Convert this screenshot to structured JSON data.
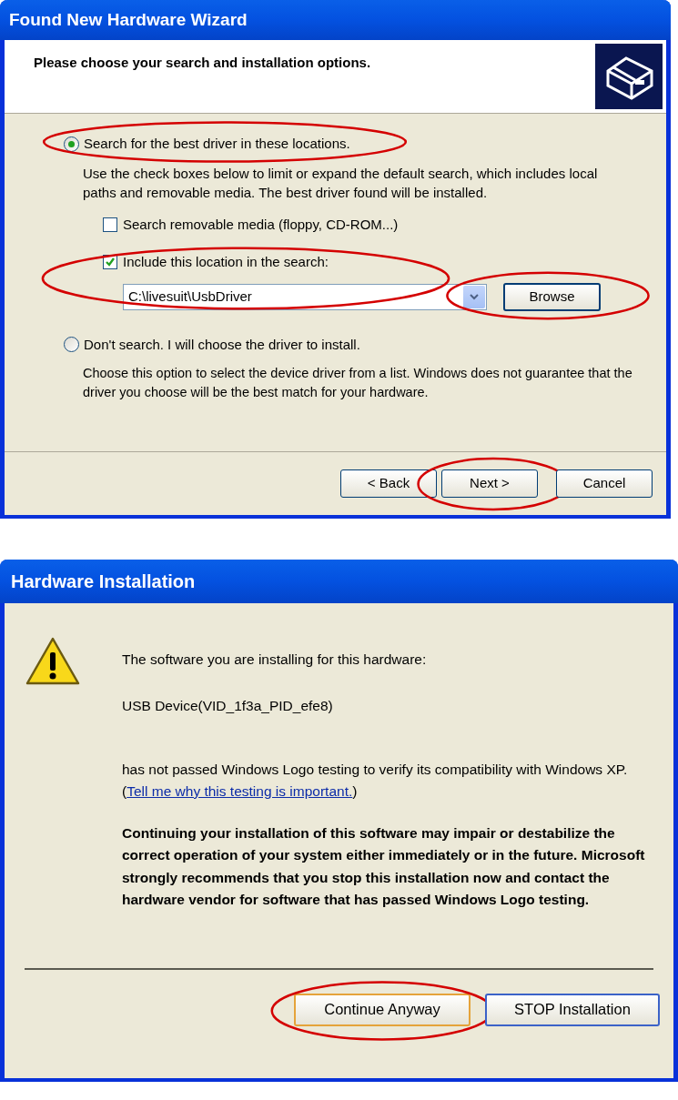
{
  "wizard": {
    "title": "Found New Hardware Wizard",
    "heading": "Please choose your search and installation options.",
    "options": [
      {
        "label": "Search for the best driver in these locations.",
        "selected": true,
        "highlighted": true,
        "description": "Use the check boxes below to limit or expand the default search, which includes local paths and removable media. The best driver found will be installed.",
        "checkboxes": [
          {
            "label": "Search removable media (floppy, CD-ROM...)",
            "checked": false
          },
          {
            "label": "Include this location in the search:",
            "checked": true,
            "highlighted": true
          }
        ],
        "location": {
          "value": "C:\\livesuit\\UsbDriver"
        },
        "browse": {
          "label": "Browse",
          "highlighted": true
        }
      },
      {
        "label": "Don't search. I will choose the driver to install.",
        "selected": false,
        "description": "Choose this option to select the device driver from a list.  Windows does not guarantee that the driver you choose will be the best match for your hardware."
      }
    ],
    "buttons": [
      {
        "label": "< Back"
      },
      {
        "label": "Next >",
        "highlighted": true
      },
      {
        "label": "Cancel"
      }
    ]
  },
  "installation": {
    "title": "Hardware Installation",
    "intro": "The software you are installing for this hardware:",
    "device": "USB Device(VID_1f3a_PID_efe8)",
    "notice": "has not passed Windows Logo testing to verify its compatibility with Windows XP. (",
    "link": "Tell me why this testing is important.",
    "notice_end": ")",
    "warning": "Continuing your installation of this software may impair or destabilize the correct operation of your system either immediately or in the future. Microsoft strongly recommends that you stop this installation now and contact the hardware vendor for software that has passed Windows Logo testing.",
    "buttons": [
      {
        "label": "Continue Anyway",
        "highlighted": true
      },
      {
        "label": "STOP Installation"
      }
    ]
  }
}
